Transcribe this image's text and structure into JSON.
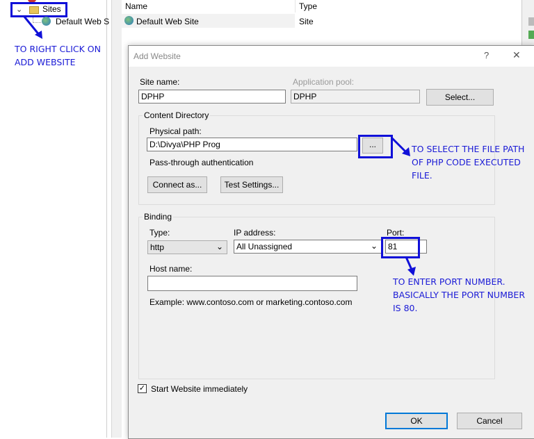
{
  "tree": {
    "sites_label": "Sites",
    "child_label": "Default Web S"
  },
  "list": {
    "col_name": "Name",
    "col_type": "Type",
    "row": {
      "name": "Default Web Site",
      "type": "Site"
    }
  },
  "dialog": {
    "title": "Add Website",
    "help": "?",
    "close": "✕",
    "site_name_label": "Site name:",
    "site_name_value": "DPHP",
    "app_pool_label": "Application pool:",
    "app_pool_value": "DPHP",
    "select_button": "Select...",
    "content_dir_label": "Content Directory",
    "physical_path_label": "Physical path:",
    "physical_path_value": "D:\\Divya\\PHP Prog",
    "browse_button": "...",
    "passthrough_label": "Pass-through authentication",
    "connect_as_button": "Connect as...",
    "test_settings_button": "Test Settings...",
    "binding_label": "Binding",
    "type_label": "Type:",
    "type_value": "http",
    "ip_label": "IP address:",
    "ip_value": "All Unassigned",
    "port_label": "Port:",
    "port_value": "81",
    "host_label": "Host name:",
    "host_value": "",
    "example_text": "Example: www.contoso.com or marketing.contoso.com",
    "start_label": "Start Website immediately",
    "start_checked": true,
    "ok_button": "OK",
    "cancel_button": "Cancel"
  },
  "annotations": {
    "right_click": [
      "TO RIGHT CLICK ON",
      "ADD WEBSITE"
    ],
    "file_path": [
      "TO SELECT THE FILE PATH",
      "OF PHP CODE EXECUTED",
      "FILE."
    ],
    "port": [
      "TO ENTER PORT NUMBER.",
      "BASICALLY THE PORT NUMBER",
      "IS 80."
    ]
  },
  "colors": {
    "annotation": "#1010d8",
    "dialog_bg": "#f0f0f0"
  }
}
